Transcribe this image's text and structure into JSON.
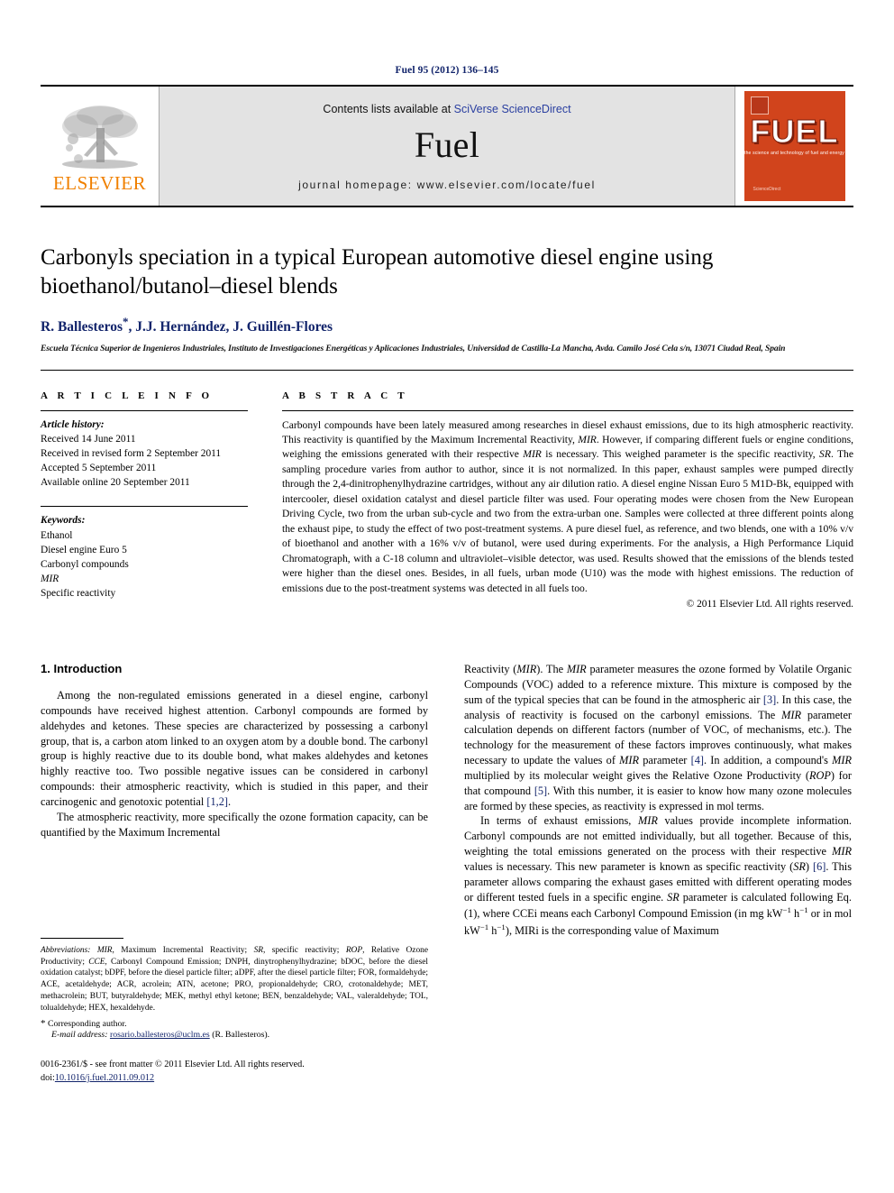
{
  "running_head": "Fuel 95 (2012) 136–145",
  "masthead": {
    "publisher_logo_text": "ELSEVIER",
    "contents_prefix": "Contents lists available at ",
    "contents_link": "SciVerse ScienceDirect",
    "journal_name": "Fuel",
    "homepage": "journal homepage: www.elsevier.com/locate/fuel",
    "cover": {
      "title": "FUEL",
      "subtitle": "the science and technology of fuel and energy",
      "footer": "ScienceDirect"
    }
  },
  "article": {
    "title": "Carbonyls speciation in a typical European automotive diesel engine using bioethanol/butanol–diesel blends",
    "authors": "R. Ballesteros, J.J. Hernández, J. Guillén-Flores",
    "corresponding_marker": "*",
    "affiliation": "Escuela Técnica Superior de Ingenieros Industriales, Instituto de Investigaciones Energéticas y Aplicaciones Industriales, Universidad de Castilla-La Mancha, Avda. Camilo José Cela s/n, 13071 Ciudad Real, Spain"
  },
  "article_info": {
    "heading": "A R T I C L E  I N F O",
    "history_label": "Article history:",
    "history": [
      "Received 14 June 2011",
      "Received in revised form 2 September 2011",
      "Accepted 5 September 2011",
      "Available online 20 September 2011"
    ],
    "keywords_label": "Keywords:",
    "keywords": [
      "Ethanol",
      "Diesel engine Euro 5",
      "Carbonyl compounds",
      "MIR",
      "Specific reactivity"
    ]
  },
  "abstract": {
    "heading": "A B S T R A C T",
    "text": "Carbonyl compounds have been lately measured among researches in diesel exhaust emissions, due to its high atmospheric reactivity. This reactivity is quantified by the Maximum Incremental Reactivity, MIR. However, if comparing different fuels or engine conditions, weighing the emissions generated with their respective MIR is necessary. This weighed parameter is the specific reactivity, SR. The sampling procedure varies from author to author, since it is not normalized. In this paper, exhaust samples were pumped directly through the 2,4-dinitrophenylhydrazine cartridges, without any air dilution ratio. A diesel engine Nissan Euro 5 M1D-Bk, equipped with intercooler, diesel oxidation catalyst and diesel particle filter was used. Four operating modes were chosen from the New European Driving Cycle, two from the urban sub-cycle and two from the extra-urban one. Samples were collected at three different points along the exhaust pipe, to study the effect of two post-treatment systems. A pure diesel fuel, as reference, and two blends, one with a 10% v/v of bioethanol and another with a 16% v/v of butanol, were used during experiments. For the analysis, a High Performance Liquid Chromatograph, with a C-18 column and ultraviolet–visible detector, was used. Results showed that the emissions of the blends tested were higher than the diesel ones. Besides, in all fuels, urban mode (U10) was the mode with highest emissions. The reduction of emissions due to the post-treatment systems was detected in all fuels too.",
    "copyright": "© 2011 Elsevier Ltd. All rights reserved."
  },
  "introduction": {
    "heading": "1. Introduction",
    "left_p1": "Among the non-regulated emissions generated in a diesel engine, carbonyl compounds have received highest attention. Carbonyl compounds are formed by aldehydes and ketones. These species are characterized by possessing a carbonyl group, that is, a carbon atom linked to an oxygen atom by a double bond. The carbonyl group is highly reactive due to its double bond, what makes aldehydes and ketones highly reactive too. Two possible negative issues can be considered in carbonyl compounds: their atmospheric reactivity, which is studied in this paper, and their carcinogenic and genotoxic potential [1,2].",
    "left_p2": "The atmospheric reactivity, more specifically the ozone formation capacity, can be quantified by the Maximum Incremental",
    "right_p1": "Reactivity (MIR). The MIR parameter measures the ozone formed by Volatile Organic Compounds (VOC) added to a reference mixture. This mixture is composed by the sum of the typical species that can be found in the atmospheric air [3]. In this case, the analysis of reactivity is focused on the carbonyl emissions. The MIR parameter calculation depends on different factors (number of VOC, of mechanisms, etc.). The technology for the measurement of these factors improves continuously, what makes necessary to update the values of MIR parameter [4]. In addition, a compound's MIR multiplied by its molecular weight gives the Relative Ozone Productivity (ROP) for that compound [5]. With this number, it is easier to know how many ozone molecules are formed by these species, as reactivity is expressed in mol terms.",
    "right_p2": "In terms of exhaust emissions, MIR values provide incomplete information. Carbonyl compounds are not emitted individually, but all together. Because of this, weighting the total emissions generated on the process with their respective MIR values is necessary. This new parameter is known as specific reactivity (SR) [6]. This parameter allows comparing the exhaust gases emitted with different operating modes or different tested fuels in a specific engine. SR parameter is calculated following Eq. (1), where CCEi means each Carbonyl Compound Emission (in mg kW−1 h−1 or in mol kW−1 h−1), MIRi is the corresponding value of Maximum"
  },
  "footnotes": {
    "abbrev_label": "Abbreviations:",
    "abbrev_text": "MIR, Maximum Incremental Reactivity; SR, specific reactivity; ROP, Relative Ozone Productivity; CCE, Carbonyl Compound Emission; DNPH, dinytrophenylhydrazine; bDOC, before the diesel oxidation catalyst; bDPF, before the diesel particle filter; aDPF, after the diesel particle filter; FOR, formaldehyde; ACE, acetaldehyde; ACR, acrolein; ATN, acetone; PRO, propionaldehyde; CRO, crotonaldehyde; MET, methacrolein; BUT, butyraldehyde; MEK, methyl ethyl ketone; BEN, benzaldehyde; VAL, valeraldehyde; TOL, tolualdehyde; HEX, hexaldehyde.",
    "corresponding": "Corresponding author.",
    "email_label": "E-mail address:",
    "email": "rosario.ballesteros@uclm.es",
    "email_suffix": "(R. Ballesteros).",
    "issn_line": "0016-2361/$ - see front matter © 2011 Elsevier Ltd. All rights reserved.",
    "doi_label": "doi:",
    "doi": "10.1016/j.fuel.2011.09.012"
  },
  "colors": {
    "link": "#12246b",
    "elsevier_orange": "#f08000",
    "cover_orange": "#d1441c",
    "masthead_grey": "#e3e3e3"
  }
}
